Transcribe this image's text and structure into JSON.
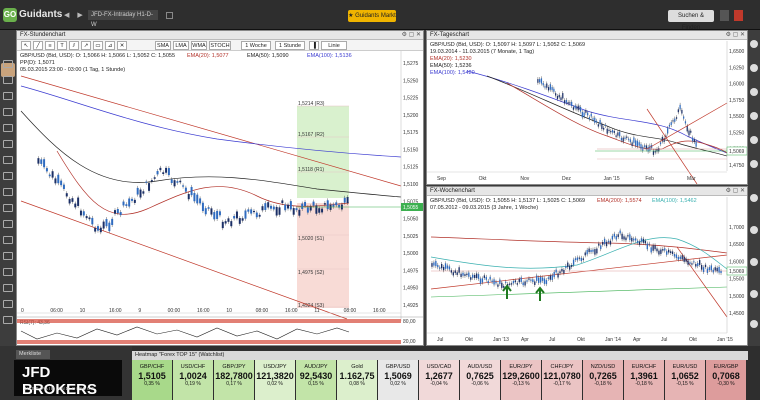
{
  "app": {
    "brand": "Guidants",
    "window_title": "JFD-FX-Intraday H1-D-W",
    "market_button": "Guidants Markt",
    "search_button": "Suchen & Finden"
  },
  "panel_main": {
    "title": "FX-Stundenchart",
    "toolbar": {
      "buttons": [
        "SMA",
        "LMA",
        "WMA",
        "STOCH"
      ],
      "range": "1 Woche",
      "interval": "1 Stunde",
      "mode": "Linie"
    },
    "info_lines": [
      "GBP/USD (Bid, USD): O: 1,5066 H: 1,5066 L: 1,5052 C: 1,5055",
      "PP(D): 1,5071",
      "05.03.2015 23:00 - 03:00 (1 Tag, 1 Stunde)"
    ],
    "legend": [
      {
        "label": "EMA(20): 1,5077",
        "color": "#b2322a"
      },
      {
        "label": "EMA(50): 1,5090",
        "color": "#222222"
      },
      {
        "label": "EMA(100): 1,5136",
        "color": "#3a3ad0"
      }
    ],
    "price_ticks": [
      "1,5275",
      "1,5250",
      "1,5225",
      "1,5200",
      "1,5175",
      "1,5150",
      "1,5125",
      "1,5100",
      "1,5075",
      "1,5050",
      "1,5025",
      "1,5000",
      "1,4975",
      "1,4950",
      "1,4925"
    ],
    "time_ticks": [
      "0",
      "06:00",
      "10",
      "16:00",
      "9",
      "00:00",
      "16:00",
      "10",
      "08:00",
      "16:00",
      "11",
      "08:00",
      "16:00"
    ],
    "pivot_labels": [
      "1,5214 (R3)",
      "1,5167 (R2)",
      "1,5118 (R1)",
      "1,5020 (S1)",
      "1,4975 (S2)",
      "1,4924 (S3)"
    ],
    "rsi_label": "RSI(7): 43,36",
    "rsi_ticks": [
      "80,00",
      "20,00"
    ],
    "price_label": "1,5055"
  },
  "panel_daily": {
    "title": "FX-Tageschart",
    "info_lines": [
      "GBP/USD (Bid, USD): O: 1,5097 H: 1,5097 L: 1,5052 C: 1,5069",
      "19.03.2014 - 11.03.2015 (7 Monate, 1 Tag)"
    ],
    "legend": [
      {
        "label": "EMA(20): 1,5230",
        "color": "#b2322a"
      },
      {
        "label": "EMA(50): 1,5236",
        "color": "#222222"
      },
      {
        "label": "EMA(100): 1,5420",
        "color": "#3a3ad0"
      }
    ],
    "price_ticks": [
      "1,6500",
      "1,6250",
      "1,6000",
      "1,5750",
      "1,5500",
      "1,5250",
      "1,5000",
      "1,4750"
    ],
    "time_ticks": [
      "Sep",
      "Okt",
      "Nov",
      "Dez",
      "Jan '15",
      "Feb",
      "Mär"
    ],
    "price_label": "1,5069"
  },
  "panel_weekly": {
    "title": "FX-Wochenchart",
    "info_lines": [
      "GBP/USD (Bid, USD): O: 1,5055 H: 1,5137 L: 1,5025 C: 1,5069",
      "07.05.2012 - 09.03.2015 (3 Jahre, 1 Woche)"
    ],
    "legend": [
      {
        "label": "EMA(200): 1,5574",
        "color": "#b2322a"
      },
      {
        "label": "EMA(100): 1,5462",
        "color": "#3ab0b0"
      }
    ],
    "price_ticks": [
      "1,7000",
      "1,6500",
      "1,6000",
      "1,5500",
      "1,5000",
      "1,4500"
    ],
    "time_ticks": [
      "Jul",
      "Okt",
      "Jan '13",
      "Apr",
      "Jul",
      "Okt",
      "Jan '14",
      "Apr",
      "Jul",
      "Okt",
      "Jan '15"
    ],
    "price_label": "1,5069"
  },
  "bottom": {
    "tab": "Merkliste",
    "broker": "JFD BROKERS",
    "broker_sub": "JUST FAIR AND DIRECT",
    "heatmap_title": "Heatmap \"Forex TOP 15\" (Watchlist)",
    "tiles": [
      {
        "name": "GBP/CHF",
        "value": "1,5105",
        "change": "0,35 %",
        "color": "#a8d98a"
      },
      {
        "name": "USD/CHF",
        "value": "1,0024",
        "change": "0,19 %",
        "color": "#c2e4a8"
      },
      {
        "name": "GBP/JPY",
        "value": "182,7800",
        "change": "0,17 %",
        "color": "#c2e4a8"
      },
      {
        "name": "USD/JPY",
        "value": "121,3820",
        "change": "0,02 %",
        "color": "#dcefcc"
      },
      {
        "name": "AUD/JPY",
        "value": "92,5430",
        "change": "0,15 %",
        "color": "#c2e4a8"
      },
      {
        "name": "Gold",
        "value": "1.162,75",
        "change": "0,08 %",
        "color": "#dcefcc"
      },
      {
        "name": "GBP/USD",
        "value": "1,5069",
        "change": "0,02 %",
        "color": "#e8e8e8"
      },
      {
        "name": "USD/CAD",
        "value": "1,2677",
        "change": "-0,04 %",
        "color": "#f1d9d9"
      },
      {
        "name": "AUD/USD",
        "value": "0,7625",
        "change": "-0,06 %",
        "color": "#f1d9d9"
      },
      {
        "name": "EUR/JPY",
        "value": "129,2600",
        "change": "-0,13 %",
        "color": "#ebc4c4"
      },
      {
        "name": "CHF/JPY",
        "value": "121,0780",
        "change": "-0,17 %",
        "color": "#ebc4c4"
      },
      {
        "name": "NZD/USD",
        "value": "0,7265",
        "change": "-0,18 %",
        "color": "#e6b4b4"
      },
      {
        "name": "EUR/CHF",
        "value": "1,3961",
        "change": "-0,18 %",
        "color": "#e6b4b4"
      },
      {
        "name": "EUR/USD",
        "value": "1,0652",
        "change": "-0,15 %",
        "color": "#e6b4b4"
      },
      {
        "name": "EUR/GBP",
        "value": "0,7068",
        "change": "-0,30 %",
        "color": "#dd9c9c"
      }
    ]
  }
}
